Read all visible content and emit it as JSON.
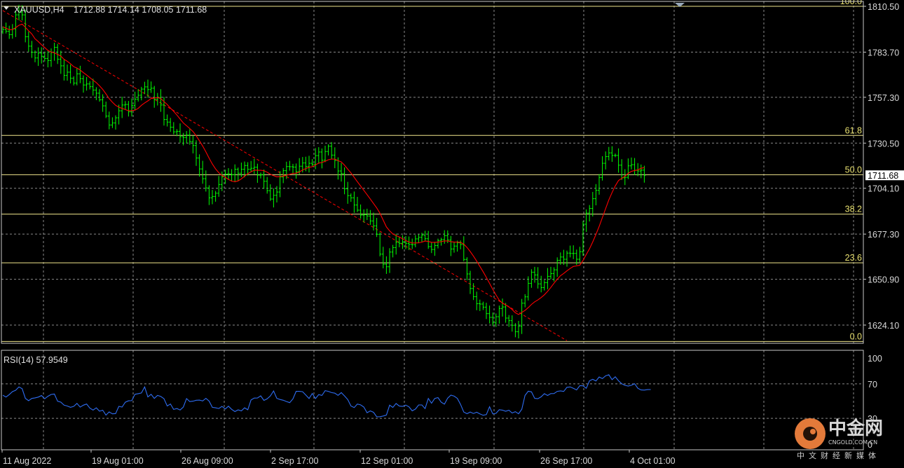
{
  "header": {
    "symbol": "XAUUSD,H4",
    "ohlc": "1712.88 1714.14 1708.05 1711.68"
  },
  "price_axis": {
    "ticks": [
      "1810.50",
      "1783.70",
      "1757.30",
      "1730.50",
      "1704.10",
      "1677.30",
      "1650.90",
      "1624.10"
    ],
    "current_price": "1711.68"
  },
  "time_axis": {
    "labels": [
      "11 Aug 2022",
      "19 Aug 01:00",
      "26 Aug 09:00",
      "2 Sep 17:00",
      "12 Sep 01:00",
      "19 Sep 09:00",
      "26 Sep 17:00",
      "4 Oct 01:00"
    ]
  },
  "fibonacci": {
    "levels": [
      {
        "label": "100.0",
        "price": 1810.5
      },
      {
        "label": "61.8",
        "price": 1735.0
      },
      {
        "label": "50.0",
        "price": 1712.0
      },
      {
        "label": "38.2",
        "price": 1689.0
      },
      {
        "label": "23.6",
        "price": 1660.5
      },
      {
        "label": "0.0",
        "price": 1614.5
      }
    ]
  },
  "rsi": {
    "label": "RSI(14) 57.9549",
    "ticks": [
      "100",
      "70",
      "30",
      "0"
    ]
  },
  "watermark": {
    "name": "中金网",
    "domain": "CNGOLD.COM.CN",
    "tagline": "中文财经新媒体"
  },
  "colors": {
    "bull": "#00ff00",
    "ma": "#ff0000",
    "rsi": "#2e6cf0",
    "fib": "#f0e68c",
    "grid": "#8a8a8a"
  },
  "chart_data": [
    {
      "type": "candlestick",
      "symbol": "XAUUSD",
      "timeframe": "H4",
      "ylim": [
        1614.0,
        1811.0
      ],
      "close": [
        1797.0,
        1795.9,
        1793.9,
        1797.3,
        1805.5,
        1807.1,
        1805.5,
        1792.7,
        1787.2,
        1783.6,
        1780.3,
        1783.1,
        1781.3,
        1780.0,
        1778.8,
        1783.5,
        1786.5,
        1779.6,
        1775.7,
        1770.1,
        1772.0,
        1768.4,
        1765.6,
        1771.0,
        1768.2,
        1764.5,
        1765.1,
        1763.5,
        1761.5,
        1759.7,
        1755.8,
        1752.3,
        1746.3,
        1741.1,
        1742.3,
        1745.3,
        1749.4,
        1752.8,
        1753.1,
        1748.8,
        1752.5,
        1756.2,
        1758.5,
        1762.1,
        1763.4,
        1761.8,
        1762.6,
        1756.1,
        1757.1,
        1752.8,
        1744.3,
        1742.8,
        1739.8,
        1737.1,
        1737.4,
        1734.3,
        1733.8,
        1735.2,
        1731.4,
        1729.1,
        1721.8,
        1715.4,
        1709.7,
        1704.3,
        1698.5,
        1699.3,
        1701.2,
        1706.3,
        1710.8,
        1712.4,
        1712.5,
        1712.0,
        1715.2,
        1712.9,
        1715.2,
        1717.4,
        1715.2,
        1715.8,
        1716.4,
        1711.8,
        1711.9,
        1708.2,
        1702.7,
        1697.8,
        1700.0,
        1701.9,
        1710.7,
        1714.4,
        1716.8,
        1716.7,
        1716.5,
        1713.8,
        1717.0,
        1718.9,
        1716.8,
        1718.7,
        1718.1,
        1723.2,
        1725.3,
        1720.5,
        1725.6,
        1728.7,
        1723.5,
        1720.4,
        1714.2,
        1712.7,
        1703.8,
        1699.8,
        1698.5,
        1694.3,
        1691.3,
        1688.4,
        1688.6,
        1687.9,
        1685.0,
        1682.1,
        1677.2,
        1665.6,
        1659.7,
        1658.2,
        1666.8,
        1669.4,
        1672.5,
        1671.9,
        1672.7,
        1671.9,
        1671.3,
        1671.1,
        1674.5,
        1675.4,
        1676.7,
        1674.6,
        1670.0,
        1668.3,
        1670.6,
        1673.6,
        1674.1,
        1676.4,
        1673.8,
        1668.6,
        1670.3,
        1672.2,
        1671.2,
        1662.5,
        1654.0,
        1645.5,
        1640.7,
        1636.6,
        1636.4,
        1634.6,
        1630.8,
        1628.6,
        1625.4,
        1629.0,
        1633.8,
        1634.7,
        1628.2,
        1626.7,
        1624.0,
        1620.2,
        1623.5,
        1636.9,
        1640.6,
        1648.5,
        1655.0,
        1653.4,
        1648.2,
        1646.0,
        1648.9,
        1652.6,
        1654.2,
        1656.4,
        1662.0,
        1663.9,
        1662.6,
        1666.2,
        1666.0,
        1666.0,
        1662.6,
        1667.0,
        1683.1,
        1689.6,
        1692.3,
        1698.0,
        1702.9,
        1710.4,
        1718.7,
        1722.6,
        1724.8,
        1723.3,
        1723.3,
        1717.6,
        1710.2,
        1710.5,
        1717.2,
        1717.9,
        1714.6,
        1714.2,
        1714.7,
        1711.7
      ],
      "ma_period_note": "red moving average",
      "ma": [
        1798.5,
        1797.7,
        1796.8,
        1796.9,
        1798.0,
        1799.4,
        1800.1,
        1798.2,
        1796.2,
        1794.3,
        1791.5,
        1789.9,
        1788.0,
        1786.4,
        1784.7,
        1783.8,
        1783.3,
        1782.4,
        1781.4,
        1779.5,
        1778.4,
        1776.9,
        1775.2,
        1774.4,
        1773.2,
        1771.7,
        1770.3,
        1768.8,
        1767.3,
        1765.9,
        1764.0,
        1761.9,
        1759.3,
        1756.5,
        1754.4,
        1752.6,
        1751.5,
        1750.8,
        1750.1,
        1749.4,
        1749.4,
        1749.8,
        1750.8,
        1752.6,
        1754.0,
        1755.2,
        1756.6,
        1756.9,
        1757.1,
        1756.6,
        1754.8,
        1753.1,
        1751.0,
        1749.1,
        1746.9,
        1744.6,
        1742.3,
        1740.7,
        1739.0,
        1737.3,
        1734.8,
        1731.9,
        1728.8,
        1725.4,
        1721.7,
        1718.3,
        1715.4,
        1713.2,
        1711.6,
        1710.5,
        1709.3,
        1708.3,
        1707.9,
        1708.4,
        1709.6,
        1711.2,
        1712.6,
        1713.7,
        1714.7,
        1714.6,
        1714.6,
        1714.4,
        1713.5,
        1712.3,
        1711.5,
        1710.8,
        1711.0,
        1711.2,
        1711.7,
        1712.2,
        1712.8,
        1712.9,
        1713.6,
        1714.8,
        1715.6,
        1716.4,
        1716.7,
        1717.7,
        1718.8,
        1719.2,
        1719.9,
        1720.8,
        1721.2,
        1721.1,
        1720.3,
        1719.5,
        1717.6,
        1715.3,
        1713.1,
        1710.5,
        1707.9,
        1705.4,
        1702.9,
        1700.4,
        1697.8,
        1695.2,
        1692.6,
        1689.5,
        1685.5,
        1681.5,
        1679.2,
        1677.4,
        1676.4,
        1675.6,
        1674.6,
        1673.5,
        1672.7,
        1672.1,
        1672.1,
        1672.2,
        1672.6,
        1673.2,
        1673.0,
        1672.5,
        1672.5,
        1672.6,
        1672.9,
        1673.3,
        1673.3,
        1672.9,
        1672.6,
        1672.6,
        1672.5,
        1671.4,
        1669.5,
        1667.1,
        1664.4,
        1661.5,
        1658.4,
        1655.3,
        1652.0,
        1648.5,
        1645.0,
        1641.7,
        1638.7,
        1636.9,
        1635.9,
        1634.7,
        1633.2,
        1631.3,
        1630.3,
        1631.5,
        1632.7,
        1634.3,
        1636.2,
        1637.7,
        1638.8,
        1640.2,
        1641.8,
        1643.8,
        1646.1,
        1648.6,
        1650.9,
        1653.0,
        1654.3,
        1655.8,
        1657.2,
        1658.4,
        1658.7,
        1659.1,
        1661.9,
        1665.4,
        1668.7,
        1672.7,
        1677.1,
        1681.8,
        1687.0,
        1692.2,
        1697.3,
        1701.6,
        1705.5,
        1708.6,
        1709.9,
        1711.1,
        1712.8,
        1714.0,
        1714.5,
        1714.8,
        1715.8,
        1716.2
      ],
      "trendline": {
        "style": "dashed",
        "from": {
          "time": "11 Aug 2022",
          "price": 1808
        },
        "to": {
          "time": "26 Sep 17:00",
          "price": 1615
        }
      }
    },
    {
      "type": "line",
      "name": "RSI(14)",
      "ylim": [
        0,
        100
      ],
      "values": [
        56.8,
        54.7,
        57.6,
        61.0,
        62.6,
        66.4,
        64.4,
        53.2,
        50.5,
        53.1,
        53.7,
        54.6,
        56.4,
        52.7,
        55.6,
        57.7,
        58.2,
        49.8,
        48.8,
        45.3,
        44.3,
        42.8,
        43.9,
        47.3,
        43.0,
        45.3,
        46.6,
        41.9,
        39.6,
        42.2,
        38.3,
        39.4,
        33.7,
        37.5,
        35.2,
        35.5,
        43.9,
        43.1,
        48.7,
        50.3,
        50.5,
        57.9,
        58.6,
        59.4,
        66.4,
        54.8,
        57.9,
        53.1,
        56.6,
        55.4,
        52.8,
        44.3,
        46.7,
        40.3,
        41.4,
        39.7,
        43.1,
        52.9,
        49.4,
        49.9,
        51.0,
        51.1,
        50.2,
        53.2,
        50.0,
        42.8,
        42.2,
        41.4,
        43.9,
        40.8,
        44.1,
        40.4,
        37.8,
        39.8,
        38.6,
        42.2,
        39.9,
        51.3,
        53.5,
        53.6,
        56.1,
        50.8,
        52.6,
        55.9,
        61.8,
        53.2,
        51.9,
        51.0,
        49.5,
        48.2,
        52.6,
        61.3,
        61.3,
        60.9,
        57.0,
        53.0,
        58.9,
        52.9,
        57.6,
        56.6,
        62.1,
        61.3,
        59.8,
        59.2,
        56.7,
        59.8,
        56.0,
        51.8,
        44.3,
        42.5,
        46.6,
        45.6,
        43.1,
        36.5,
        38.6,
        37.0,
        31.8,
        31.9,
        32.7,
        33.8,
        45.3,
        42.7,
        47.2,
        44.2,
        43.8,
        45.4,
        43.3,
        38.7,
        40.7,
        45.5,
        45.5,
        41.3,
        53.1,
        47.6,
        53.1,
        54.1,
        48.7,
        46.4,
        53.4,
        56.9,
        55.8,
        53.2,
        46.2,
        37.3,
        35.4,
        37.3,
        35.6,
        37.1,
        35.1,
        33.6,
        34.3,
        43.5,
        35.1,
        35.8,
        40.0,
        39.5,
        38.2,
        39.4,
        36.2,
        37.7,
        35.3,
        40.6,
        56.6,
        61.5,
        60.7,
        53.2,
        52.8,
        55.0,
        58.6,
        56.5,
        58.7,
        58.8,
        61.3,
        61.9,
        61.2,
        66.0,
        66.4,
        64.9,
        62.9,
        68.0,
        67.7,
        64.9,
        73.6,
        75.3,
        73.3,
        78.0,
        76.1,
        79.3,
        80.6,
        74.9,
        78.2,
        73.6,
        70.2,
        68.3,
        67.5,
        68.4,
        70.2,
        64.9,
        62.9,
        62.8,
        63.3,
        63.4
      ],
      "last_value": 57.9549
    }
  ]
}
